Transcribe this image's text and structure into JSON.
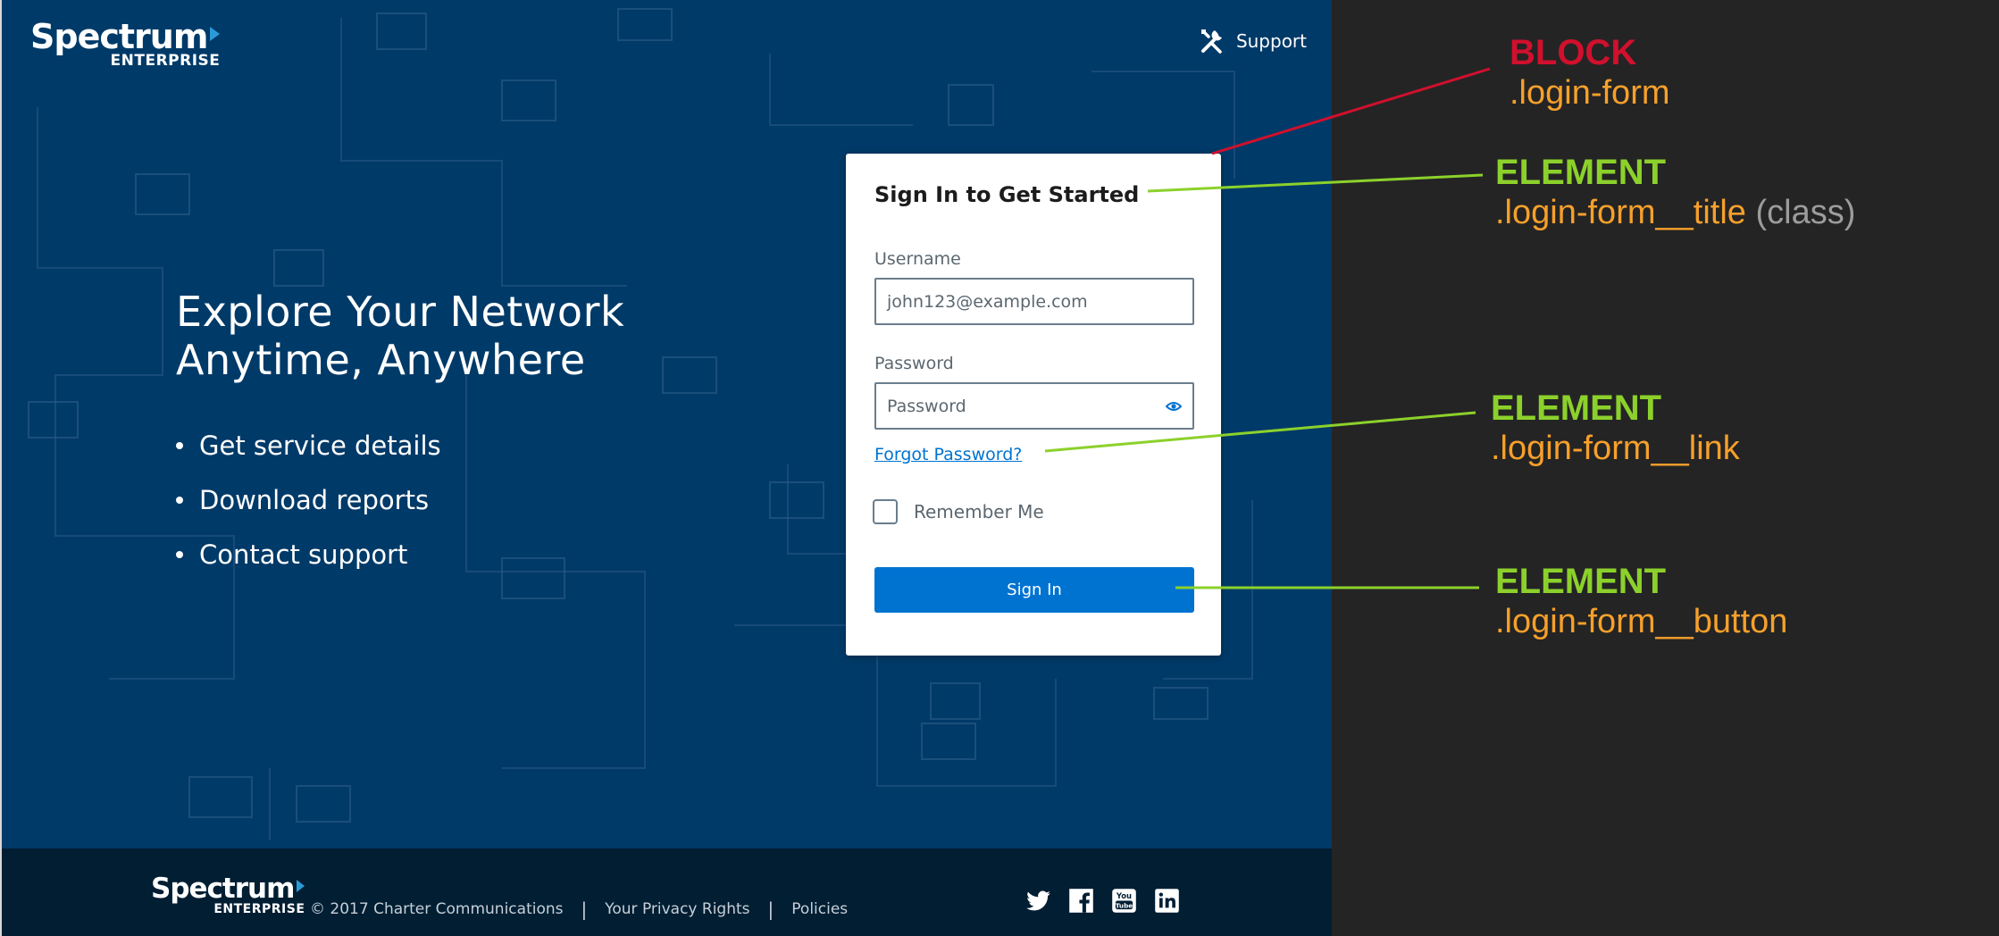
{
  "site": {
    "logo": {
      "name": "Spectrum",
      "sub": "ENTERPRISE"
    },
    "support_label": "Support",
    "hero": {
      "title_line1": "Explore Your Network",
      "title_line2": "Anytime, Anywhere",
      "bullets": [
        "Get service details",
        "Download reports",
        "Contact support"
      ]
    },
    "login_form": {
      "title": "Sign In to Get Started",
      "username_label": "Username",
      "username_value": "john123@example.com",
      "password_label": "Password",
      "password_placeholder": "Password",
      "forgot_link": "Forgot Password?",
      "remember_label": "Remember Me",
      "remember_checked": false,
      "signin_button": "Sign In"
    },
    "footer": {
      "copyright": "© 2017 Charter Communications",
      "links": [
        "Your Privacy Rights",
        "Policies"
      ],
      "social_icons": [
        "twitter-icon",
        "facebook-icon",
        "youtube-icon",
        "linkedin-icon"
      ]
    }
  },
  "annotations": [
    {
      "kind": "BLOCK",
      "class": ".login-form",
      "note": "",
      "color": "#d0102d"
    },
    {
      "kind": "ELEMENT",
      "class": ".login-form__title",
      "note": "(class)",
      "color": "#8cd12b"
    },
    {
      "kind": "ELEMENT",
      "class": ".login-form__link",
      "note": "",
      "color": "#8cd12b"
    },
    {
      "kind": "ELEMENT",
      "class": ".login-form__button",
      "note": "",
      "color": "#8cd12b"
    }
  ],
  "colors": {
    "page_bg": "#003a68",
    "footer_bg": "#011e33",
    "button_blue": "#0073d1",
    "panel_bg": "#242424",
    "block_red": "#d0102d",
    "element_green": "#8cd12b",
    "class_orange": "#f6a02b"
  }
}
